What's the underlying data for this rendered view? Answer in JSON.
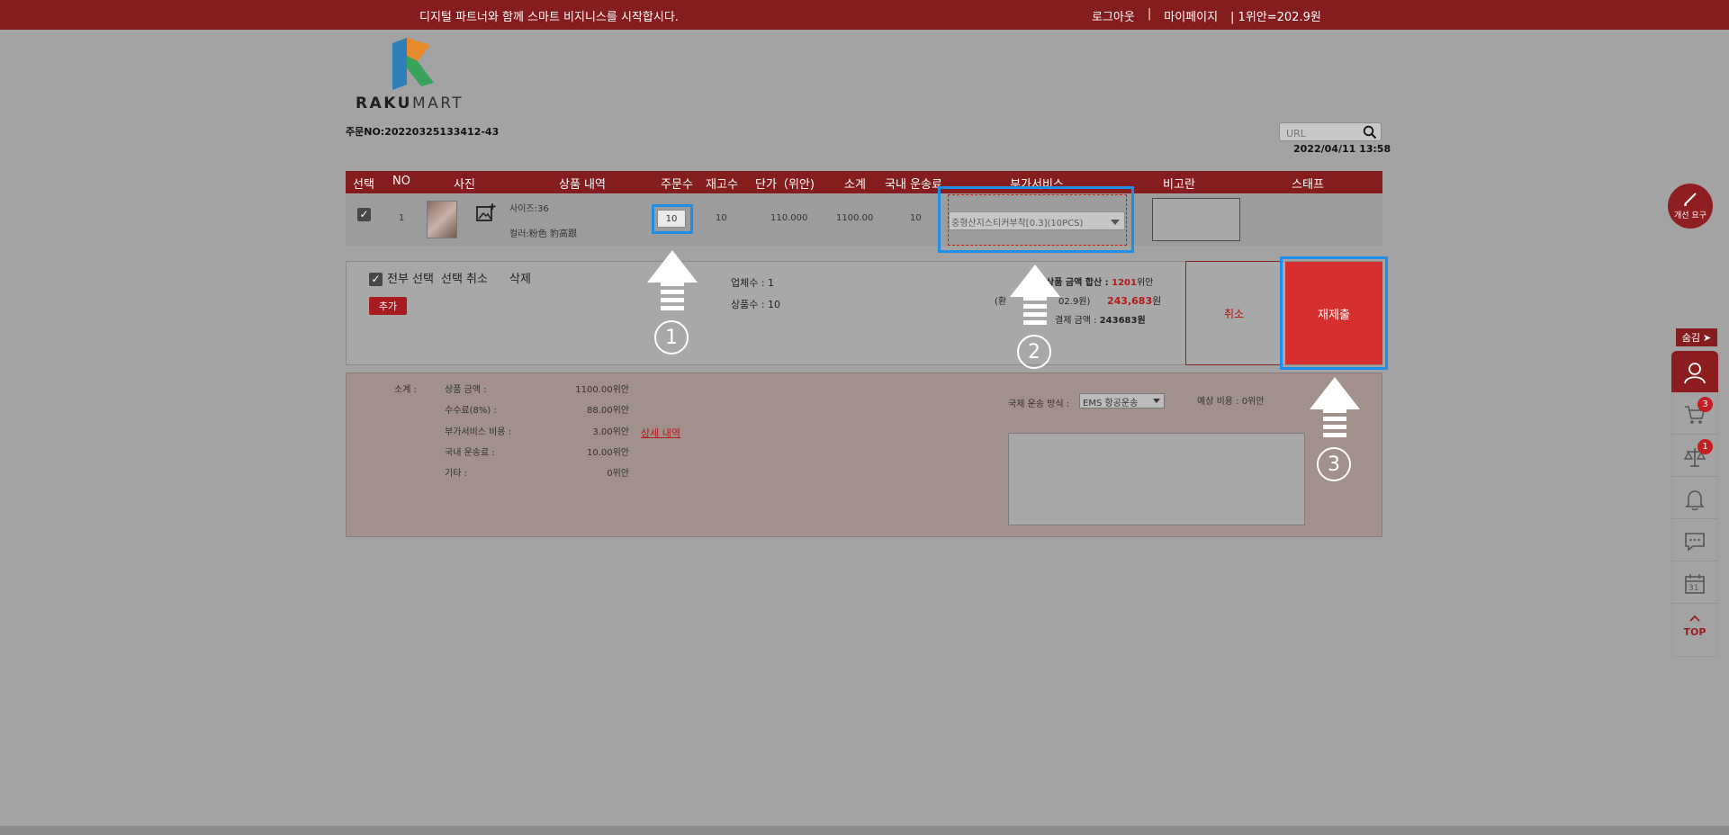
{
  "topbar": {
    "slogan": "디지털 파트너와 함께 스마트 비지니스를 시작합시다.",
    "logout": "로그아웃",
    "divider": "|",
    "mypage": "마이페이지",
    "rate": "|  1위안=202.9원"
  },
  "logo": {
    "brand_bold": "RAKU",
    "brand_light": "MART"
  },
  "order": {
    "no": "주문NO:20220325133412-43",
    "date": "2022/04/11 13:58"
  },
  "search": {
    "placeholder": "URL"
  },
  "table": {
    "headers": [
      "선택",
      "NO",
      "사진",
      "상품 내역",
      "주문수",
      "재고수",
      "단가（위안)",
      "소계",
      "국내 운송료",
      "부가서비스",
      "비고란",
      "스태프"
    ]
  },
  "row": {
    "no": "1",
    "size": "사이즈:36",
    "color": "컬러:粉色 豹高跟",
    "qty": "10",
    "stock": "10",
    "price": "110.000",
    "subtotal": "1100.00",
    "shipping": "10",
    "service": "중형산지스티커부착[0.3](10PCS)"
  },
  "summary": {
    "select_all": "전부 선택",
    "deselect": "선택 취소",
    "delete": "삭제",
    "add": "추가",
    "vendors": "업체수 : 1",
    "items": "상품수 : 10",
    "total_label": "상품 금액 합산 : ",
    "total_value": "1201",
    "total_unit": "위안",
    "krw_label": "02.9원)",
    "krw_prefix": "(환",
    "krw_value": "243,683",
    "krw_unit": "원",
    "pay_label": "결제 금액 : ",
    "pay_value": "243683원",
    "cancel": "취소",
    "resubmit": "재제출"
  },
  "detail": {
    "subtotal_label": "소계 :",
    "lines": [
      {
        "label": "상품 금액 :",
        "value": "1100.00위안"
      },
      {
        "label": "수수료(8%) :",
        "value": "88.00위안"
      },
      {
        "label": "부가서비스 비용 :",
        "value": "3.00위안"
      },
      {
        "label": "국내 운송료 :",
        "value": "10.00위안"
      },
      {
        "label": "기타 :",
        "value": "0위안"
      }
    ],
    "detail_link": "상세 내역",
    "ship_method_label": "국제 운송 방식 :",
    "ship_method_value": "EMS 항공운송",
    "estimate": "예상 비용 : 0위안"
  },
  "steps": [
    "1",
    "2",
    "3"
  ],
  "sidebar": {
    "improve": "개선 요구",
    "hide": "숨김",
    "cart_badge": "3",
    "compare_badge": "1",
    "calendar_day": "31",
    "top": "TOP"
  },
  "colors": {
    "brand": "#851c1e",
    "highlight": "#1e8ee6",
    "resubmit": "#d5302f"
  }
}
